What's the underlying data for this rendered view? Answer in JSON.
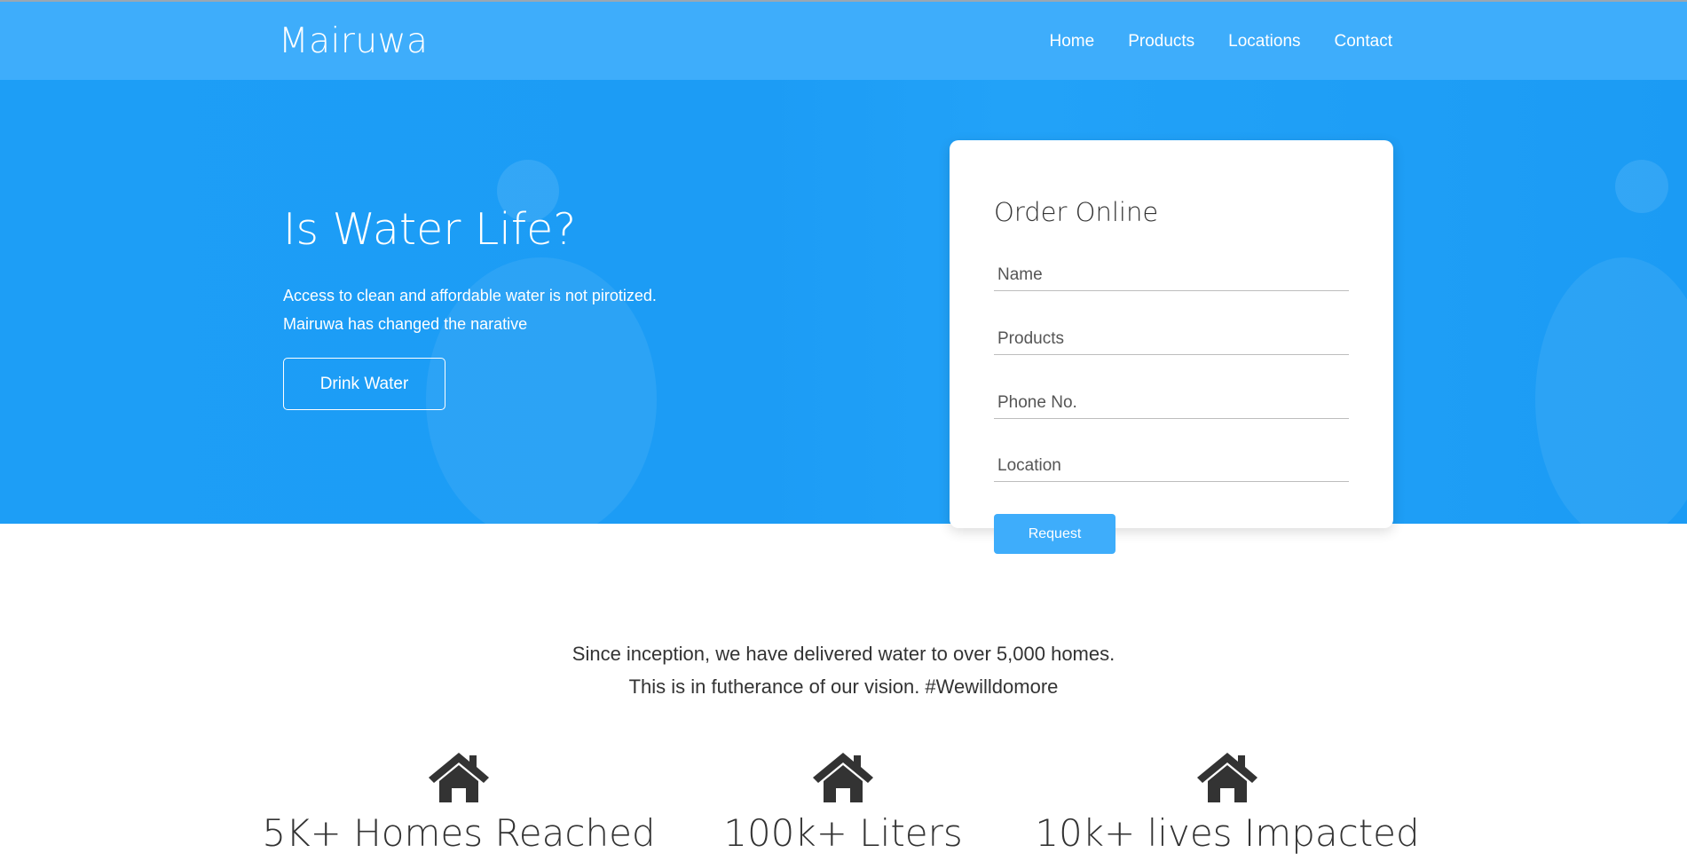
{
  "nav": {
    "brand": "Mairuwa",
    "links": [
      "Home",
      "Products",
      "Locations",
      "Contact"
    ]
  },
  "hero": {
    "title": "Is Water Life?",
    "line1": "Access to clean and affordable water is not pirotized.",
    "line2": "Mairuwa has changed the narative",
    "cta": "Drink Water"
  },
  "order": {
    "title": "Order Online",
    "fields": {
      "name": "Name",
      "products": "Products",
      "phone": "Phone No.",
      "location": "Location"
    },
    "submit": "Request"
  },
  "intro": {
    "line1": "Since inception, we have delivered water to over 5,000 homes.",
    "line2": "This is in futherance of our vision. #Wewilldomore"
  },
  "stats": [
    {
      "icon": "home-icon",
      "label": "5K+ Homes Reached"
    },
    {
      "icon": "home-icon",
      "label": "100k+ Liters"
    },
    {
      "icon": "home-icon",
      "label": "10k+ lives Impacted"
    }
  ],
  "colors": {
    "primary": "#3eadfb",
    "hero": "#1d9ef6",
    "text": "#333333"
  }
}
